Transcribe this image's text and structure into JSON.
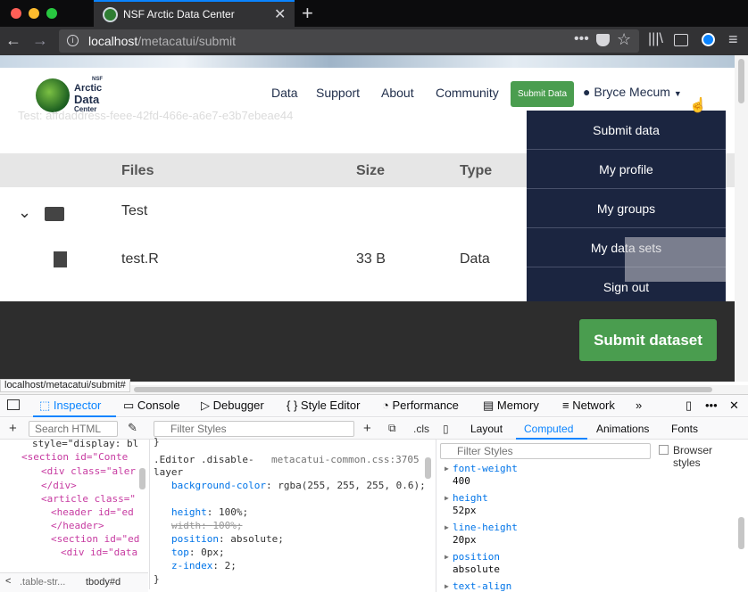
{
  "browser": {
    "tab_title": "NSF Arctic Data Center",
    "url_host": "localhost",
    "url_path": "/metacatui/submit",
    "status_url": "localhost/metacatui/submit#"
  },
  "site": {
    "logo_small": "NSF",
    "logo_line1": "Arctic",
    "logo_line2": "Data",
    "logo_line3": "Center",
    "nav": [
      "Data",
      "Support",
      "About",
      "Community"
    ],
    "submit_button": "Submit Data",
    "user_name": "Bryce Mecum",
    "dropdown": [
      "Submit data",
      "My profile",
      "My groups",
      "My data sets",
      "Sign out"
    ],
    "ghost_text": "Test: affdaddress-feee-42fd-466e-a6e7-e3b7ebeae44",
    "table": {
      "headers": [
        "Files",
        "Size",
        "Type"
      ],
      "rows": [
        {
          "name": "Test",
          "size": "",
          "type": ""
        },
        {
          "name": "test.R",
          "size": "33 B",
          "type": "Data"
        }
      ]
    },
    "submit_dataset": "Submit dataset"
  },
  "devtools": {
    "tabs": [
      "Inspector",
      "Console",
      "Debugger",
      "Style Editor",
      "Performance",
      "Memory",
      "Network"
    ],
    "search_placeholder": "Search HTML",
    "filter_styles": "Filter Styles",
    "cls": ".cls",
    "right_tabs": [
      "Layout",
      "Computed",
      "Animations",
      "Fonts"
    ],
    "browser_styles": "Browser styles",
    "markup": [
      "style=\"display: bl",
      "<section id=\"Conte",
      "<div class=\"aler",
      "</div>",
      "<article class=\"",
      "<header id=\"ed",
      "</header>",
      "<section id=\"ed",
      "<div id=\"data"
    ],
    "rule_selector": ".Editor .disable-layer",
    "rule_source": "metacatui-common.css:3705",
    "rules": [
      {
        "prop": "background-color",
        "val": "rgba(255, 255, 255, 0.6)"
      },
      {
        "prop": "height",
        "val": "100%"
      },
      {
        "prop": "width",
        "val": "100%"
      },
      {
        "prop": "position",
        "val": "absolute"
      },
      {
        "prop": "top",
        "val": "0px"
      },
      {
        "prop": "z-index",
        "val": "2"
      }
    ],
    "computed": [
      {
        "prop": "font-weight",
        "val": "400"
      },
      {
        "prop": "height",
        "val": "52px"
      },
      {
        "prop": "line-height",
        "val": "20px"
      },
      {
        "prop": "position",
        "val": "absolute"
      },
      {
        "prop": "text-align",
        "val": ""
      }
    ],
    "breadcrumbs": [
      ".table-str...",
      "tbody#d"
    ]
  },
  "colors": {
    "accent": "#0a84ff",
    "brand_green": "#4a9d4f",
    "nav_dark": "#1b2540"
  }
}
